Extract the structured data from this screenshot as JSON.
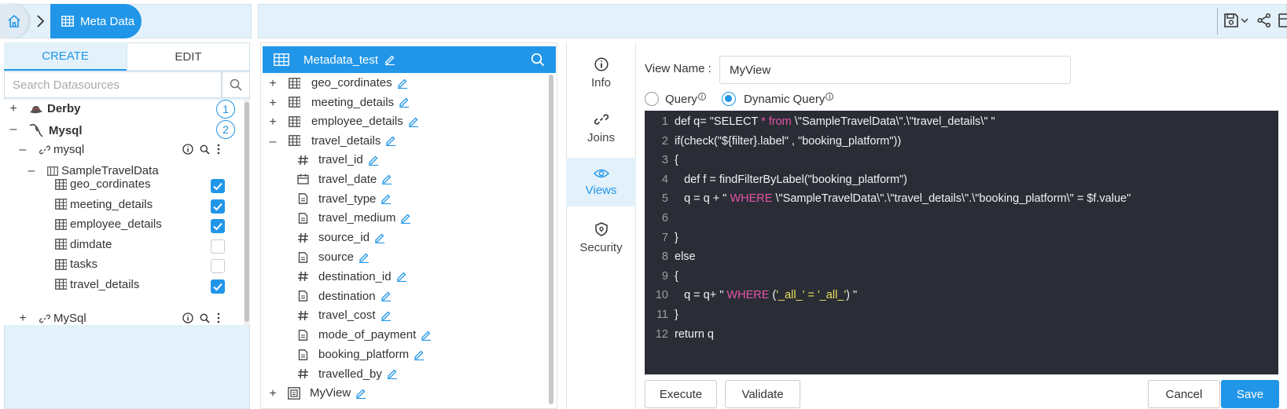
{
  "breadcrumb": {
    "current": "Meta Data"
  },
  "left": {
    "tabs": {
      "create": "CREATE",
      "edit": "EDIT"
    },
    "search_placeholder": "Search Datasources",
    "derby": {
      "label": "Derby",
      "badge": "1"
    },
    "mysql": {
      "label": "Mysql",
      "badge": "2"
    },
    "connection": "mysql",
    "schema": "SampleTravelData",
    "tables": [
      {
        "label": "geo_cordinates",
        "checked": true
      },
      {
        "label": "meeting_details",
        "checked": true
      },
      {
        "label": "employee_details",
        "checked": true
      },
      {
        "label": "dimdate",
        "checked": false
      },
      {
        "label": "tasks",
        "checked": false
      },
      {
        "label": "travel_details",
        "checked": true
      }
    ],
    "second_connection": "MySql"
  },
  "middle": {
    "title": "Metadata_test",
    "tables": [
      "geo_cordinates",
      "meeting_details",
      "employee_details",
      "travel_details"
    ],
    "columns": [
      {
        "label": "travel_id",
        "icon": "hash-icon"
      },
      {
        "label": "travel_date",
        "icon": "calendar-icon"
      },
      {
        "label": "travel_type",
        "icon": "document-icon"
      },
      {
        "label": "travel_medium",
        "icon": "document-icon"
      },
      {
        "label": "source_id",
        "icon": "hash-icon"
      },
      {
        "label": "source",
        "icon": "document-icon"
      },
      {
        "label": "destination_id",
        "icon": "hash-icon"
      },
      {
        "label": "destination",
        "icon": "document-icon"
      },
      {
        "label": "travel_cost",
        "icon": "hash-icon"
      },
      {
        "label": "mode_of_payment",
        "icon": "document-icon"
      },
      {
        "label": "booking_platform",
        "icon": "document-icon"
      },
      {
        "label": "travelled_by",
        "icon": "hash-icon"
      }
    ],
    "view": "MyView"
  },
  "side_menu": {
    "info": "Info",
    "joins": "Joins",
    "views": "Views",
    "security": "Security"
  },
  "editor": {
    "view_name_label": "View Name :",
    "view_name_value": "MyView",
    "query_label": "Query",
    "dynamic_label": "Dynamic Query",
    "lines": [
      {
        "n": "1",
        "a": "def q= \"SELECT ",
        "b": "* from",
        "c": " \\\"SampleTravelData\\\".\\\"travel_details\\\" \"",
        "y": ""
      },
      {
        "n": "2",
        "a": "if(check(\"${filter}.label\" , \"booking_platform\"))",
        "b": "",
        "c": "",
        "y": ""
      },
      {
        "n": "3",
        "a": "{",
        "b": "",
        "c": "",
        "y": ""
      },
      {
        "n": "4",
        "a": "   def f = findFilterByLabel(\"booking_platform\")",
        "b": "",
        "c": "",
        "y": ""
      },
      {
        "n": "5",
        "a": "   q = q + \" ",
        "b": "WHERE",
        "c": " \\\"SampleTravelData\\\".\\\"travel_details\\\".\\\"booking_platform\\\" = $f.value\"",
        "y": ""
      },
      {
        "n": "6",
        "a": "",
        "b": "",
        "c": "",
        "y": ""
      },
      {
        "n": "7",
        "a": "}",
        "b": "",
        "c": "",
        "y": ""
      },
      {
        "n": "8",
        "a": "else",
        "b": "",
        "c": "",
        "y": ""
      },
      {
        "n": "9",
        "a": "{",
        "b": "",
        "c": "",
        "y": ""
      },
      {
        "n": "10",
        "a": "   q = q+ \" ",
        "b": "WHERE",
        "c": " (",
        "y": "'_all_' = '_all_'",
        "d": ") \""
      },
      {
        "n": "11",
        "a": "}",
        "b": "",
        "c": "",
        "y": ""
      },
      {
        "n": "12",
        "a": "return q",
        "b": "",
        "c": "",
        "y": ""
      }
    ]
  },
  "buttons": {
    "execute": "Execute",
    "validate": "Validate",
    "cancel": "Cancel",
    "save": "Save"
  },
  "colors": {
    "accent": "#2196e8",
    "panel_bg": "#e3f1fa",
    "code_bg": "#2a2d36",
    "keyword": "#e554a6",
    "string": "#e8e05a"
  }
}
